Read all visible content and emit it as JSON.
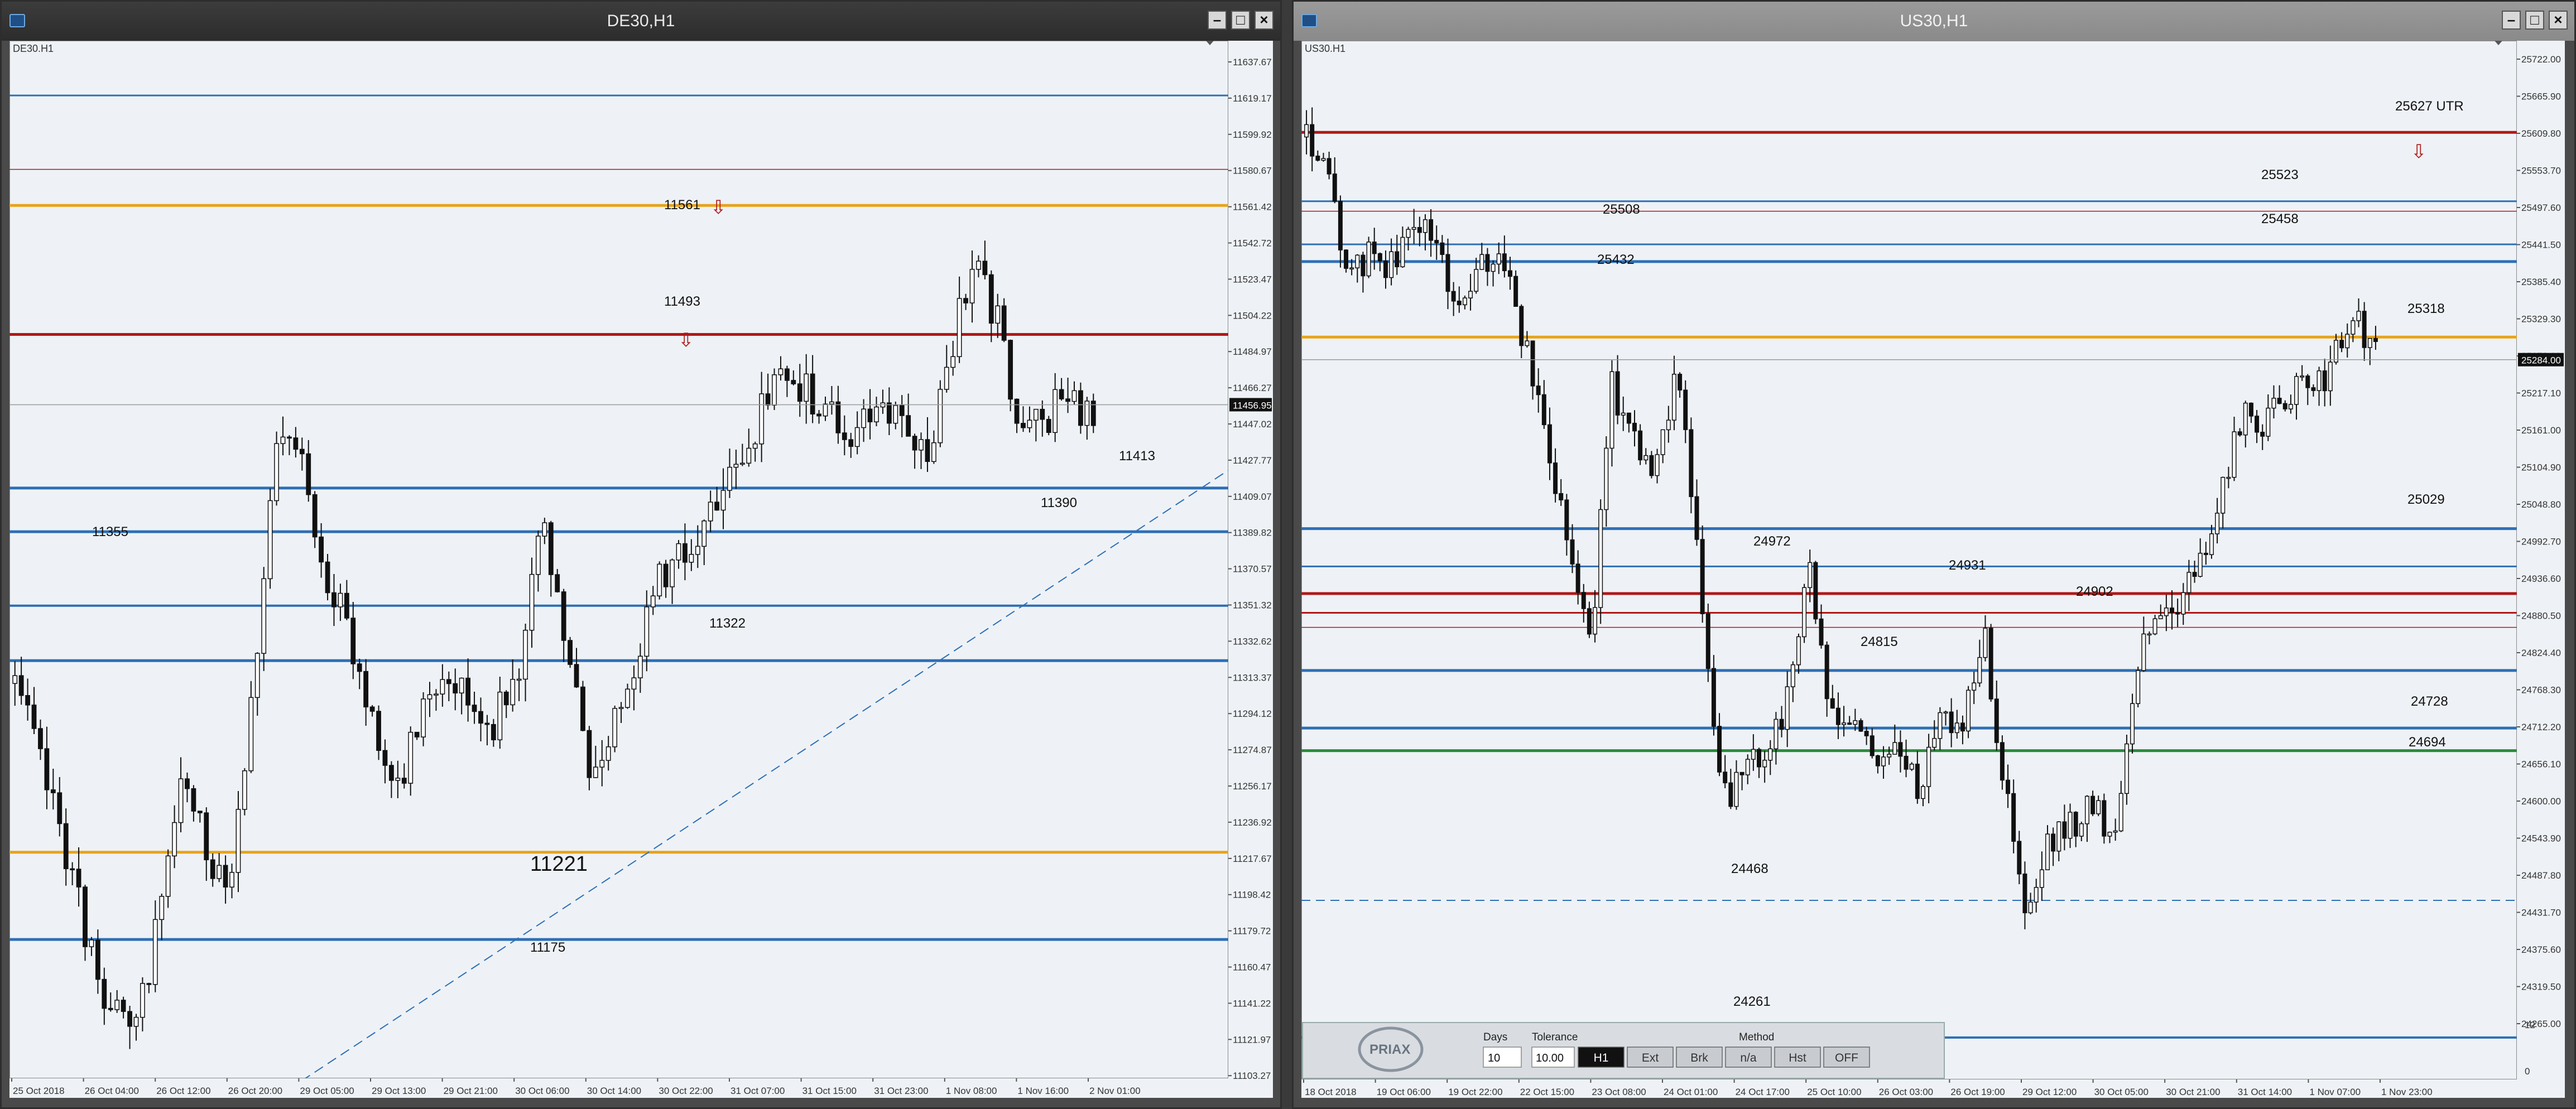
{
  "left": {
    "window_title": "DE30,H1",
    "symbol_label": "DE30.H1",
    "current_price": "11456.95",
    "price_axis": [
      "11637.67",
      "11619.17",
      "11599.92",
      "11580.67",
      "11561.42",
      "11542.72",
      "11523.47",
      "11504.22",
      "11484.97",
      "11466.27",
      "11447.02",
      "11427.77",
      "11409.07",
      "11389.82",
      "11370.57",
      "11351.32",
      "11332.62",
      "11313.37",
      "11294.12",
      "11274.87",
      "11256.17",
      "11236.92",
      "11217.67",
      "11198.42",
      "11179.72",
      "11160.47",
      "11141.22",
      "11121.97",
      "11103.27"
    ],
    "time_axis": [
      "25 Oct 2018",
      "26 Oct 04:00",
      "26 Oct 12:00",
      "26 Oct 20:00",
      "29 Oct 05:00",
      "29 Oct 13:00",
      "29 Oct 21:00",
      "30 Oct 06:00",
      "30 Oct 14:00",
      "30 Oct 22:00",
      "31 Oct 07:00",
      "31 Oct 15:00",
      "31 Oct 23:00",
      "1 Nov 08:00",
      "1 Nov 16:00",
      "2 Nov 01:00"
    ],
    "levels": [
      "11561",
      "11493",
      "11413",
      "11390",
      "11355",
      "11322",
      "11221",
      "11175"
    ]
  },
  "right": {
    "window_title": "US30,H1",
    "symbol_label": "US30.H1",
    "current_price": "25284.00",
    "price_axis": [
      "25722.00",
      "25665.90",
      "25609.80",
      "25553.70",
      "25497.60",
      "25441.50",
      "25385.40",
      "25329.30",
      "25273.20",
      "25217.10",
      "25161.00",
      "25104.90",
      "25048.80",
      "24992.70",
      "24936.60",
      "24880.50",
      "24824.40",
      "24768.30",
      "24712.20",
      "24656.10",
      "24600.00",
      "24543.90",
      "24487.80",
      "24431.70",
      "24375.60",
      "24319.50",
      "24265.00"
    ],
    "time_axis": [
      "18 Oct 2018",
      "19 Oct 06:00",
      "19 Oct 22:00",
      "22 Oct 15:00",
      "23 Oct 08:00",
      "24 Oct 01:00",
      "24 Oct 17:00",
      "25 Oct 10:00",
      "26 Oct 03:00",
      "26 Oct 19:00",
      "29 Oct 12:00",
      "30 Oct 05:00",
      "30 Oct 21:00",
      "31 Oct 14:00",
      "1 Nov 07:00",
      "1 Nov 23:00"
    ],
    "levels": [
      "25627 UTR",
      "25523",
      "25508",
      "25458",
      "25432",
      "25318",
      "25029",
      "24972",
      "24931",
      "24902",
      "24815",
      "24728",
      "24694",
      "24468",
      "24261"
    ],
    "toolbar": {
      "logo": "PRIAX",
      "days_label": "Days",
      "days_value": "10",
      "tolerance_label": "Tolerance",
      "tolerance_value": "10.00",
      "method_label": "Method",
      "buttons": [
        "H1",
        "Ext",
        "Brk",
        "n/a",
        "Hst",
        "OFF"
      ],
      "volume_axis": [
        "12",
        "0"
      ]
    }
  },
  "colors": {
    "line_blue": "#2e6fb5",
    "line_red": "#b01818",
    "line_orange": "#e8a317",
    "line_green": "#2a8a3a",
    "candle": "#111111"
  }
}
